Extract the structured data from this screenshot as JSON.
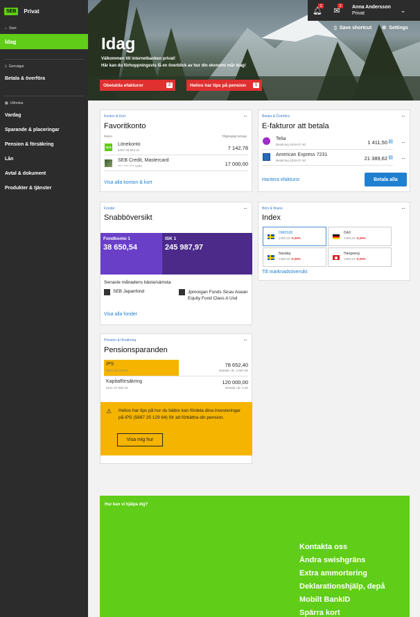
{
  "brand": {
    "logo": "SEB",
    "name": "Privat"
  },
  "sidebar": {
    "start_label": "Start",
    "active_item": "Idag",
    "shortcuts_label": "Genvägar",
    "shortcut_item": "Betala & överföra",
    "explore_label": "Utforska",
    "items": [
      {
        "label": "Vardag"
      },
      {
        "label": "Sparande & placeringar"
      },
      {
        "label": "Pension & försäkring"
      },
      {
        "label": "Lån"
      },
      {
        "label": "Avtal & dokument"
      },
      {
        "label": "Produkter & tjänster"
      }
    ]
  },
  "topbar": {
    "notifications_count": "2",
    "messages_count": "2",
    "user_name": "Anna Andersson",
    "user_type": "Privat"
  },
  "hero": {
    "title": "Idag",
    "welcome": "Välkommen till internetbanken privat!",
    "subtitle": "Här kan du förhoppningsvis få en överblick av hur din ekonomi mår idag!",
    "save_shortcut": "Save shortcut",
    "settings": "Settings",
    "btn_invoices": "Obetalda efakturor",
    "btn_invoices_count": "2",
    "btn_tips": "Helios har tips på pension",
    "btn_tips_count": "1"
  },
  "favorites": {
    "category": "Konton & Kort",
    "title": "Favoritkonto",
    "col_name": "Namn",
    "col_amount": "Tillgängligt belopp",
    "rows": [
      {
        "name": "Lönekonto",
        "number": "5267 08 654 21",
        "amount": "7 142,78",
        "icon": "seb-icon"
      },
      {
        "name": "SEB Credit, Mastercard",
        "number": "**** **** **** 1234",
        "amount": "17 000,00",
        "icon": "card-icon"
      }
    ],
    "link": "Visa alla konton & kort"
  },
  "efakturor": {
    "category": "Betala & Överföra",
    "title": "E-fakturor att betala",
    "rows": [
      {
        "name": "Telia",
        "date": "Betalning 2019-07-30",
        "amount": "1 411,50"
      },
      {
        "name": "American Express 7231",
        "date": "Betalning 2019-07-30",
        "amount": "21 389,62"
      }
    ],
    "link": "Hantera efakturor",
    "pay_all": "Betala alla"
  },
  "funds": {
    "category": "Fonder",
    "title": "Snabböversikt",
    "tile1_label": "Fondkonto 1",
    "tile1_value": "38 650,54",
    "tile2_label": "ISK 1",
    "tile2_value": "245 987,97",
    "best_worst": "Senaste månadens bästa/sämsta",
    "best": "SEB Japanfond",
    "worst": "Jpmorgan Funds Sicav Asean Equity Fund Class A Usd",
    "link": "Visa alla fonder",
    "color_tile1": "#6a3fc8",
    "color_tile2": "#4b2a8a"
  },
  "index": {
    "category": "Börs & finans",
    "title": "Index",
    "items": [
      {
        "name": "OMXS30",
        "value": "1492,22",
        "change": "-0,26%",
        "flag": "se"
      },
      {
        "name": "DAX",
        "value": "1490,23",
        "change": "-0,26%",
        "flag": "de"
      },
      {
        "name": "Nasdaq",
        "value": "1492,22",
        "change": "-0,26%",
        "flag": "se"
      },
      {
        "name": "Hangseng",
        "value": "1492,22",
        "change": "-0,26%",
        "flag": "hk"
      }
    ],
    "link": "Till marknadsöversikt"
  },
  "pension": {
    "category": "Pension & försäkring",
    "title": "Pensionsparanden",
    "rows": [
      {
        "name": "IPS",
        "number": "5697 25 129 64",
        "amount": "78 652,40",
        "deposited": "Inbetalt i år: 2 687,90"
      },
      {
        "name": "Kapitalförsäkring",
        "number": "6151 37 000 23",
        "amount": "120 000,00",
        "deposited": "Inbetalt i år: 0,00"
      }
    ],
    "tip": "Helios har tips på hur du bättre kan fördela dina investeringar på IPS (5697 25 129 64) för att förbättra din pension.",
    "tip_button": "Visa mig hur",
    "color_tip": "#f5b400"
  },
  "help": {
    "question": "Hur kan vi hjälpa dig?",
    "links": [
      "Kontakta oss",
      "Ändra swishgräns",
      "Extra ammortering",
      "Deklarationshjälp, depå",
      "Mobilt BankID",
      "Spärra kort"
    ]
  }
}
